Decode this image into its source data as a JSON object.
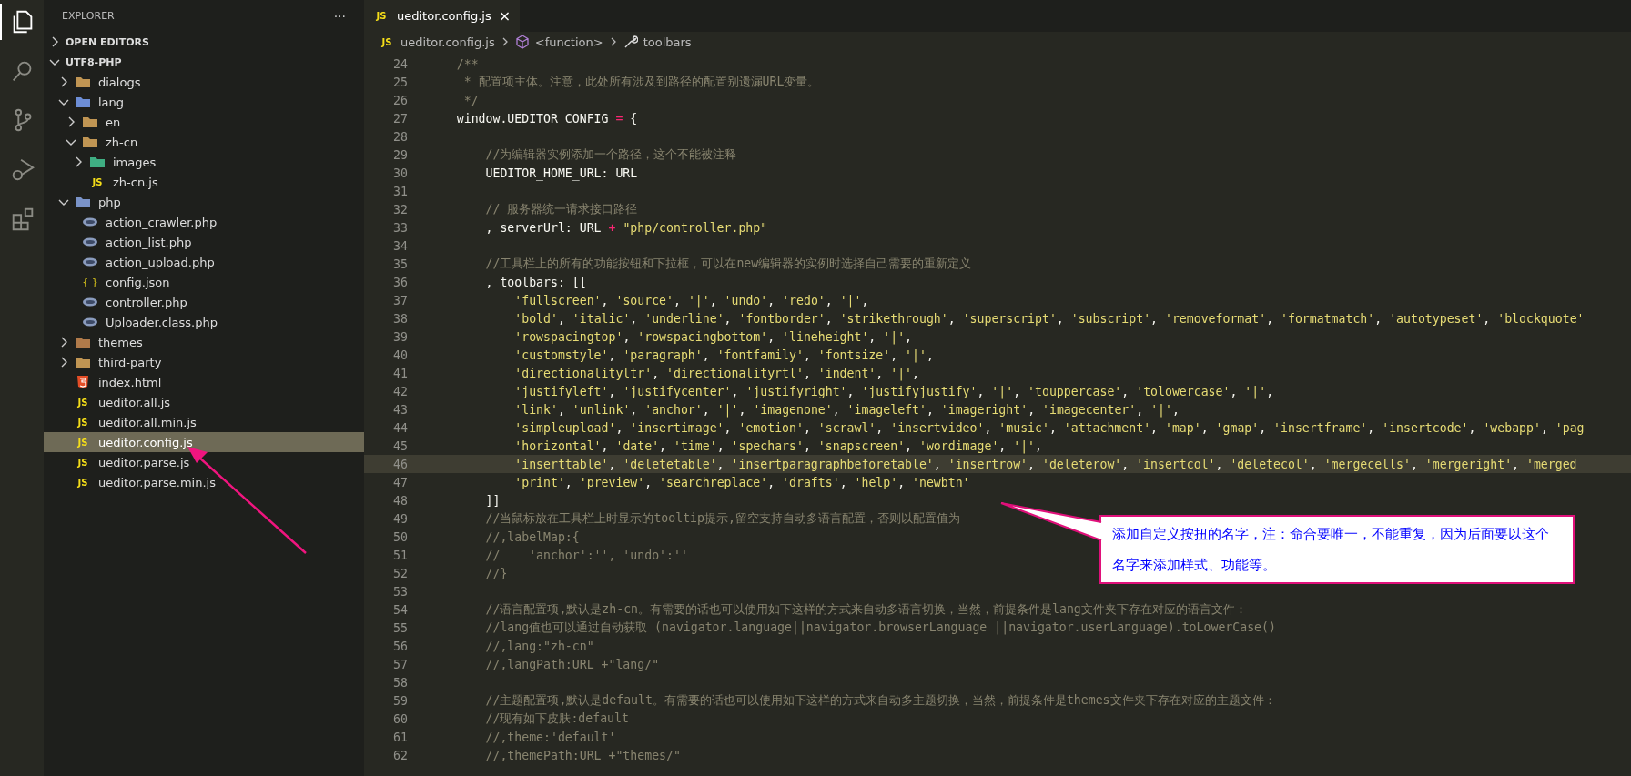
{
  "activity_bar": [
    {
      "kind": "files",
      "selected": true
    },
    {
      "kind": "search",
      "selected": false
    },
    {
      "kind": "source-control",
      "selected": false
    },
    {
      "kind": "run-debug",
      "selected": false
    },
    {
      "kind": "extensions",
      "selected": false
    }
  ],
  "sidebar": {
    "title": "EXPLORER",
    "more": "···",
    "sections": [
      {
        "label": "OPEN EDITORS",
        "expanded": false
      },
      {
        "label": "UTF8-PHP",
        "expanded": true
      }
    ],
    "tree": [
      {
        "name": "dialogs",
        "kind": "folder",
        "expanded": false,
        "selected": false
      },
      {
        "name": "lang",
        "kind": "folder-lang",
        "expanded": true,
        "selected": false,
        "children": [
          {
            "name": "en",
            "kind": "folder",
            "expanded": false,
            "selected": false
          },
          {
            "name": "zh-cn",
            "kind": "folder",
            "expanded": true,
            "selected": false,
            "children": [
              {
                "name": "images",
                "kind": "folder-images",
                "expanded": false,
                "selected": false
              },
              {
                "name": "zh-cn.js",
                "kind": "js",
                "icon": "JS",
                "selected": false
              }
            ]
          }
        ]
      },
      {
        "name": "php",
        "kind": "folder-php",
        "expanded": true,
        "selected": false,
        "children": [
          {
            "name": "action_crawler.php",
            "kind": "php",
            "selected": false
          },
          {
            "name": "action_list.php",
            "kind": "php",
            "selected": false
          },
          {
            "name": "action_upload.php",
            "kind": "php",
            "selected": false
          },
          {
            "name": "config.json",
            "kind": "json",
            "icon": "{ }",
            "selected": false
          },
          {
            "name": "controller.php",
            "kind": "php",
            "selected": false
          },
          {
            "name": "Uploader.class.php",
            "kind": "php",
            "selected": false
          }
        ]
      },
      {
        "name": "themes",
        "kind": "folder-themes",
        "expanded": false,
        "selected": false
      },
      {
        "name": "third-party",
        "kind": "folder",
        "expanded": false,
        "selected": false
      },
      {
        "name": "index.html",
        "kind": "html",
        "selected": false
      },
      {
        "name": "ueditor.all.js",
        "kind": "js",
        "icon": "JS",
        "selected": false
      },
      {
        "name": "ueditor.all.min.js",
        "kind": "js",
        "icon": "JS",
        "selected": false
      },
      {
        "name": "ueditor.config.js",
        "kind": "js",
        "icon": "JS",
        "selected": true
      },
      {
        "name": "ueditor.parse.js",
        "kind": "js",
        "icon": "JS",
        "selected": false
      },
      {
        "name": "ueditor.parse.min.js",
        "kind": "js",
        "icon": "JS",
        "selected": false
      }
    ]
  },
  "tabs": [
    {
      "icon": "JS",
      "label": "ueditor.config.js",
      "close": "×",
      "selected": true
    }
  ],
  "breadcrumbs": [
    {
      "kind": "file",
      "icon": "JS",
      "label": "ueditor.config.js"
    },
    {
      "kind": "function",
      "label": "<function>"
    },
    {
      "kind": "property",
      "label": "toolbars"
    }
  ],
  "code": [
    {
      "n": "24",
      "current": false,
      "segments": [
        {
          "kind": "comment",
          "text": "    /**"
        }
      ]
    },
    {
      "n": "25",
      "current": false,
      "segments": [
        {
          "kind": "comment",
          "text": "     * 配置项主体。注意，此处所有涉及到路径的配置别遗漏URL变量。"
        }
      ]
    },
    {
      "n": "26",
      "current": false,
      "segments": [
        {
          "kind": "comment",
          "text": "     */"
        }
      ]
    },
    {
      "n": "27",
      "current": false,
      "segments": [
        {
          "kind": "plain",
          "text": "    window.UEDITOR_CONFIG "
        },
        {
          "kind": "operator",
          "text": "="
        },
        {
          "kind": "plain",
          "text": " {"
        }
      ]
    },
    {
      "n": "28",
      "current": false
    },
    {
      "n": "29",
      "current": false,
      "segments": [
        {
          "kind": "comment",
          "text": "        //为编辑器实例添加一个路径，这个不能被注释"
        }
      ]
    },
    {
      "n": "30",
      "current": false,
      "segments": [
        {
          "kind": "plain",
          "text": "        UEDITOR_HOME_URL: URL"
        }
      ]
    },
    {
      "n": "31",
      "current": false
    },
    {
      "n": "32",
      "current": false,
      "segments": [
        {
          "kind": "comment",
          "text": "        // 服务器统一请求接口路径"
        }
      ]
    },
    {
      "n": "33",
      "current": false,
      "segments": [
        {
          "kind": "plain",
          "text": "        , serverUrl: URL "
        },
        {
          "kind": "operator",
          "text": "+"
        },
        {
          "kind": "string",
          "text": " \"php/controller.php\""
        }
      ]
    },
    {
      "n": "34",
      "current": false
    },
    {
      "n": "35",
      "current": false,
      "segments": [
        {
          "kind": "comment",
          "text": "        //工具栏上的所有的功能按钮和下拉框，可以在new编辑器的实例时选择自己需要的重新定义"
        }
      ]
    },
    {
      "n": "36",
      "current": false,
      "segments": [
        {
          "kind": "plain",
          "text": "        , toolbars: [["
        }
      ]
    },
    {
      "n": "37",
      "current": false,
      "segments": [
        {
          "kind": "string-list",
          "text": "            'fullscreen', 'source', '|', 'undo', 'redo', '|',"
        }
      ]
    },
    {
      "n": "38",
      "current": false,
      "segments": [
        {
          "kind": "string-list",
          "text": "            'bold', 'italic', 'underline', 'fontborder', 'strikethrough', 'superscript', 'subscript', 'removeformat', 'formatmatch', 'autotypeset', 'blockquote'"
        }
      ]
    },
    {
      "n": "39",
      "current": false,
      "segments": [
        {
          "kind": "string-list",
          "text": "            'rowspacingtop', 'rowspacingbottom', 'lineheight', '|',"
        }
      ]
    },
    {
      "n": "40",
      "current": false,
      "segments": [
        {
          "kind": "string-list",
          "text": "            'customstyle', 'paragraph', 'fontfamily', 'fontsize', '|',"
        }
      ]
    },
    {
      "n": "41",
      "current": false,
      "segments": [
        {
          "kind": "string-list",
          "text": "            'directionalityltr', 'directionalityrtl', 'indent', '|',"
        }
      ]
    },
    {
      "n": "42",
      "current": false,
      "segments": [
        {
          "kind": "string-list",
          "text": "            'justifyleft', 'justifycenter', 'justifyright', 'justifyjustify', '|', 'touppercase', 'tolowercase', '|',"
        }
      ]
    },
    {
      "n": "43",
      "current": false,
      "segments": [
        {
          "kind": "string-list",
          "text": "            'link', 'unlink', 'anchor', '|', 'imagenone', 'imageleft', 'imageright', 'imagecenter', '|',"
        }
      ]
    },
    {
      "n": "44",
      "current": false,
      "segments": [
        {
          "kind": "string-list",
          "text": "            'simpleupload', 'insertimage', 'emotion', 'scrawl', 'insertvideo', 'music', 'attachment', 'map', 'gmap', 'insertframe', 'insertcode', 'webapp', 'pag"
        }
      ]
    },
    {
      "n": "45",
      "current": false,
      "segments": [
        {
          "kind": "string-list",
          "text": "            'horizontal', 'date', 'time', 'spechars', 'snapscreen', 'wordimage', '|',"
        }
      ]
    },
    {
      "n": "46",
      "current": true,
      "segments": [
        {
          "kind": "string-list",
          "text": "            'inserttable', 'deletetable', 'insertparagraphbeforetable', 'insertrow', 'deleterow', 'insertcol', 'deletecol', 'mergecells', 'mergeright', 'merged"
        }
      ]
    },
    {
      "n": "47",
      "current": false,
      "segments": [
        {
          "kind": "string-list",
          "text": "            'print', 'preview', 'searchreplace', 'drafts', 'help', 'newbtn'"
        }
      ]
    },
    {
      "n": "48",
      "current": false,
      "segments": [
        {
          "kind": "plain",
          "text": "        ]]"
        }
      ]
    },
    {
      "n": "49",
      "current": false,
      "segments": [
        {
          "kind": "comment",
          "text": "        //当鼠标放在工具栏上时显示的tooltip提示,留空支持自动多语言配置，否则以配置值为"
        }
      ]
    },
    {
      "n": "50",
      "current": false,
      "segments": [
        {
          "kind": "comment",
          "text": "        //,labelMap:{"
        }
      ]
    },
    {
      "n": "51",
      "current": false,
      "segments": [
        {
          "kind": "comment",
          "text": "        //    'anchor':'', 'undo':''"
        }
      ]
    },
    {
      "n": "52",
      "current": false,
      "segments": [
        {
          "kind": "comment",
          "text": "        //}"
        }
      ]
    },
    {
      "n": "53",
      "current": false
    },
    {
      "n": "54",
      "current": false,
      "segments": [
        {
          "kind": "comment",
          "text": "        //语言配置项,默认是zh-cn。有需要的话也可以使用如下这样的方式来自动多语言切换，当然，前提条件是lang文件夹下存在对应的语言文件："
        }
      ]
    },
    {
      "n": "55",
      "current": false,
      "segments": [
        {
          "kind": "comment",
          "text": "        //lang值也可以通过自动获取 (navigator.language||navigator.browserLanguage ||navigator.userLanguage).toLowerCase()"
        }
      ]
    },
    {
      "n": "56",
      "current": false,
      "segments": [
        {
          "kind": "comment",
          "text": "        //,lang:\"zh-cn\""
        }
      ]
    },
    {
      "n": "57",
      "current": false,
      "segments": [
        {
          "kind": "comment",
          "text": "        //,langPath:URL +\"lang/\""
        }
      ]
    },
    {
      "n": "58",
      "current": false
    },
    {
      "n": "59",
      "current": false,
      "segments": [
        {
          "kind": "comment",
          "text": "        //主题配置项,默认是default。有需要的话也可以使用如下这样的方式来自动多主题切换，当然，前提条件是themes文件夹下存在对应的主题文件："
        }
      ]
    },
    {
      "n": "60",
      "current": false,
      "segments": [
        {
          "kind": "comment",
          "text": "        //现有如下皮肤:default"
        }
      ]
    },
    {
      "n": "61",
      "current": false,
      "segments": [
        {
          "kind": "comment",
          "text": "        //,theme:'default'"
        }
      ]
    },
    {
      "n": "62",
      "current": false,
      "segments": [
        {
          "kind": "comment",
          "text": "        //,themePath:URL +\"themes/\""
        }
      ]
    }
  ],
  "callout": {
    "text": "添加自定义按扭的名字，注：命合要唯一，不能重复，因为后面要以这个名字来添加样式、功能等。"
  }
}
